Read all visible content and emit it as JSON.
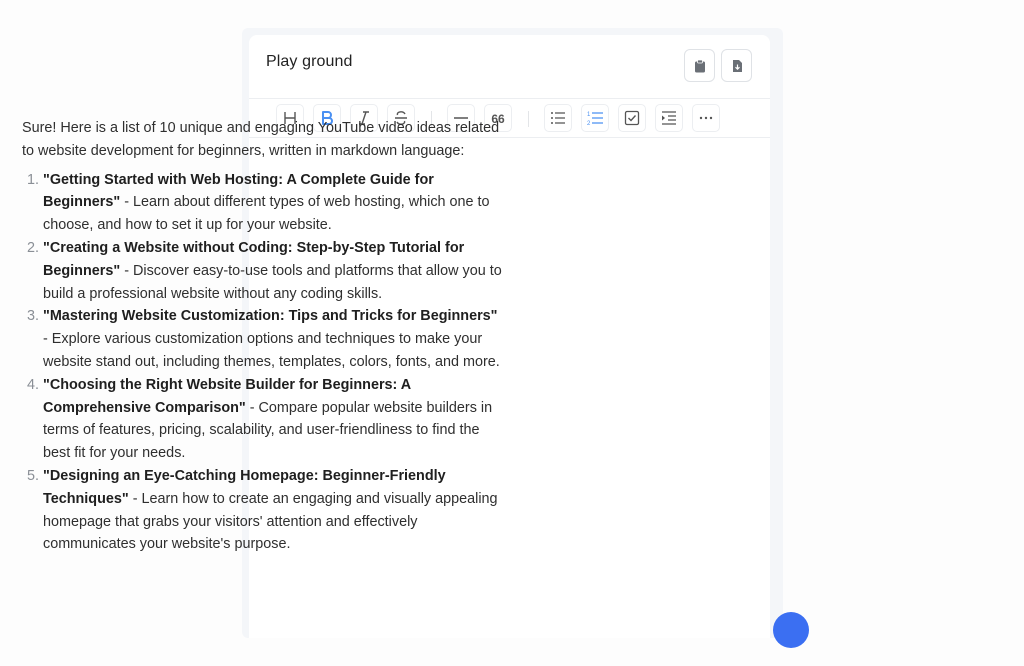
{
  "header": {
    "title": "Play ground",
    "buttons": [
      {
        "name": "clipboard-icon"
      },
      {
        "name": "download-file-icon"
      }
    ]
  },
  "toolbar": {
    "tools": [
      {
        "name": "heading",
        "glyph": "H"
      },
      {
        "name": "bold",
        "glyph": "B",
        "active": true
      },
      {
        "name": "italic",
        "glyph": "I"
      },
      {
        "name": "strikethrough",
        "glyph": "S"
      },
      {
        "name": "horizontal-rule"
      },
      {
        "name": "blockquote",
        "glyph": "66"
      },
      {
        "name": "bullet-list"
      },
      {
        "name": "ordered-list",
        "active": true
      },
      {
        "name": "task-list"
      },
      {
        "name": "indent"
      },
      {
        "name": "more"
      }
    ],
    "accent_color": "#4a90f2"
  },
  "content": {
    "intro": "Sure! Here is a list of 10 unique and engaging YouTube video ideas related to website development for beginners, written in markdown language:",
    "items": [
      {
        "bold": "\"Getting Started with Web Hosting: A Complete Guide for Beginners\"",
        "rest": " - Learn about different types of web hosting, which one to choose, and how to set it up for your website."
      },
      {
        "bold": "\"Creating a Website without Coding: Step-by-Step Tutorial for Beginners\"",
        "rest": " - Discover easy-to-use tools and platforms that allow you to build a professional website without any coding skills."
      },
      {
        "bold": "\"Mastering Website Customization: Tips and Tricks for Beginners\"",
        "rest": " - Explore various customization options and techniques to make your website stand out, including themes, templates, colors, fonts, and more."
      },
      {
        "bold": "\"Choosing the Right Website Builder for Beginners: A Comprehensive Comparison\"",
        "rest": " - Compare popular website builders in terms of features, pricing, scalability, and user-friendliness to find the best fit for your needs."
      },
      {
        "bold": "\"Designing an Eye-Catching Homepage: Beginner-Friendly Techniques\"",
        "rest": " - Learn how to create an engaging and visually appealing homepage that grabs your visitors' attention and effectively communicates your website's purpose."
      }
    ]
  },
  "fab_color": "#3b6ff2"
}
